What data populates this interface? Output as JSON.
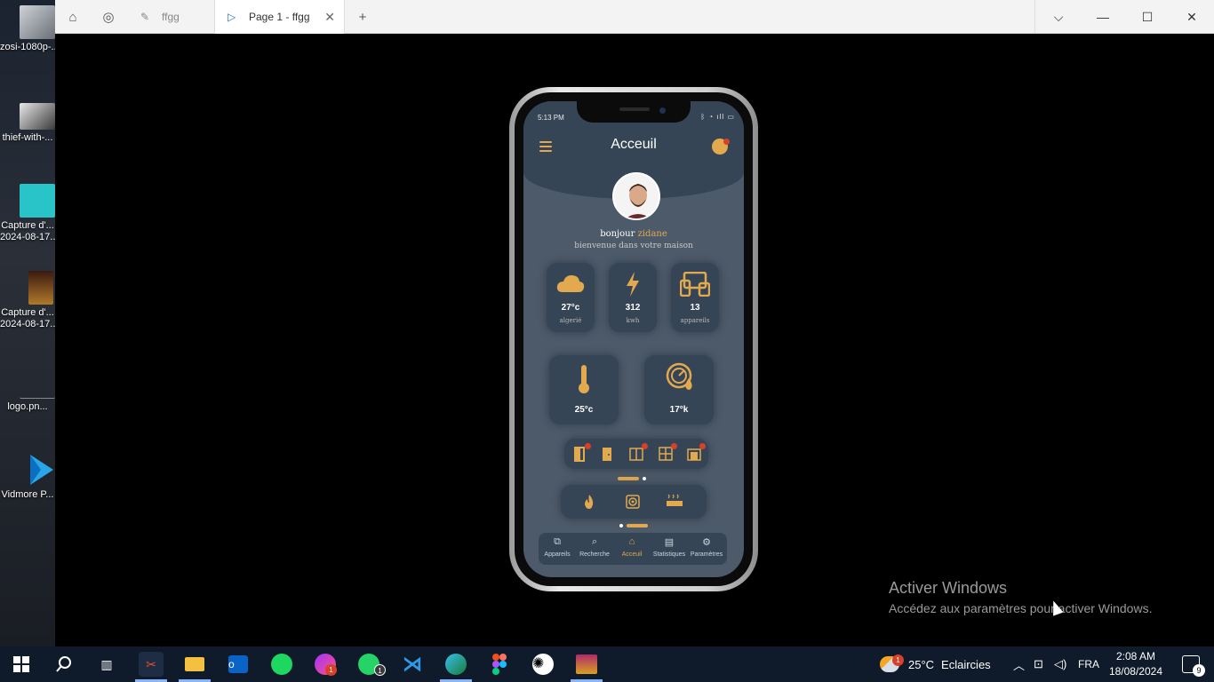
{
  "desktop": {
    "icons": [
      {
        "label": "zosi-1080p-...",
        "icon": "video-thumbnail-icon"
      },
      {
        "label": "thief-with-...",
        "icon": "image-thumbnail-icon"
      },
      {
        "label": "Capture d'...",
        "sub": "2024-08-17...",
        "icon": "portrait-thumbnail-icon"
      },
      {
        "label": "Capture d'...",
        "sub": "2024-08-17...",
        "icon": "poster-thumbnail-icon"
      },
      {
        "label": "logo.pn...",
        "icon": "logo-file-icon"
      },
      {
        "label": "Vidmore P...",
        "icon": "vidmore-player-icon"
      }
    ]
  },
  "browser": {
    "tabs": [
      {
        "label": "ffgg",
        "icon": "figma-tab-icon",
        "active": false
      },
      {
        "label": "Page 1 - ffgg",
        "icon": "play-tab-icon",
        "active": true
      }
    ],
    "new_tab": "+",
    "controls": {
      "dropdown": "⌵",
      "minimize": "—",
      "maximize": "☐",
      "close": "✕"
    }
  },
  "phone": {
    "status_time": "5:13 PM",
    "status_icons": "ᛒ ◔ ıll ▭",
    "title": "Acceuil",
    "greeting": "bonjour",
    "user_name": "zidane",
    "welcome": "bienvenue dans votre maison",
    "cards_top": [
      {
        "value": "27°c",
        "sub": "algerié",
        "icon": "cloud-icon"
      },
      {
        "value": "312",
        "sub": "kwh",
        "icon": "lightning-icon"
      },
      {
        "value": "13",
        "sub": "appareils",
        "icon": "devices-icon"
      }
    ],
    "cards_mid": [
      {
        "value": "25°c",
        "icon": "thermometer-icon"
      },
      {
        "value": "17°k",
        "icon": "water-gauge-icon"
      }
    ],
    "row_one_icons": [
      "door-open-icon",
      "door-icon",
      "window-icon",
      "grid-window-icon",
      "garage-icon"
    ],
    "row_two_icons": [
      "flame-icon",
      "speaker-icon",
      "heater-icon"
    ],
    "nav": [
      {
        "label": "Appareils",
        "icon": "devices-nav-icon",
        "glyph": "⧉"
      },
      {
        "label": "Recherche",
        "icon": "search-nav-icon",
        "glyph": "⌕"
      },
      {
        "label": "Acceuil",
        "icon": "home-nav-icon",
        "glyph": "⌂",
        "active": true
      },
      {
        "label": "Statistiques",
        "icon": "stats-nav-icon",
        "glyph": "▤"
      },
      {
        "label": "Paramètres",
        "icon": "gear-nav-icon",
        "glyph": "⚙"
      }
    ],
    "accent": "#e2a94f",
    "bg": "#4c5a6a",
    "card_bg": "#354556"
  },
  "watermark": {
    "title": "Activer Windows",
    "subtitle": "Accédez aux paramètres pour activer Windows."
  },
  "taskbar": {
    "weather_temp": "25°C",
    "weather_desc": "Eclaircies",
    "language": "FRA",
    "time": "2:08 AM",
    "date": "18/08/2024",
    "notification_count": "9",
    "messenger_badge": "1",
    "whatsapp_badge": "1",
    "weather_badge": "1"
  }
}
